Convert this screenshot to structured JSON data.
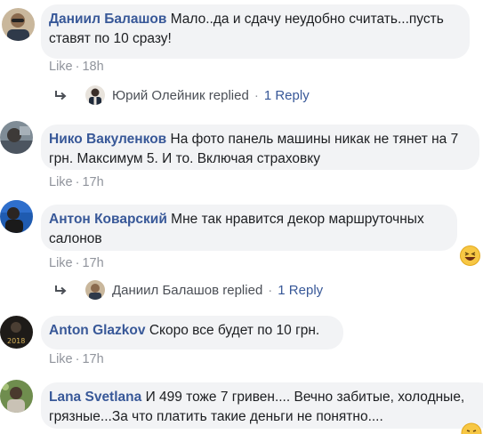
{
  "comments": [
    {
      "author": "Даниил Балашов",
      "text": "Мало..да и сдачу неудобно считать...пусть ставят по 10 сразу!",
      "like": "Like",
      "time": "18h",
      "reply": {
        "name": "Юрий Олейник replied",
        "count": "1 Reply"
      }
    },
    {
      "author": "Нико Вакуленков",
      "text": "На фото панель машины никак не тянет на 7 грн. Максимум 5. И то. Включая страховку",
      "like": "Like",
      "time": "17h"
    },
    {
      "author": "Антон Коварский",
      "text": "Мне так нравится декор маршруточных салонов",
      "like": "Like",
      "time": "17h",
      "reply": {
        "name": "Даниил Балашов replied",
        "count": "1 Reply"
      }
    },
    {
      "author": "Anton Glazkov",
      "text": "Скоро все будет по 10 грн.",
      "like": "Like",
      "time": "17h"
    },
    {
      "author": "Lana Svetlana",
      "text": "И 499 тоже 7 гривен.... Вечно забитые, холодные, грязные...За что платить такие деньги не понятно....",
      "avatar_badge": "2018"
    }
  ],
  "separator": "·",
  "colors": {
    "author": "#385898",
    "meta": "#90949c",
    "bubble": "#f2f3f5",
    "text": "#1c1e21"
  },
  "icons": [
    "reply-arrow-icon",
    "laughing-emoji-icon"
  ]
}
